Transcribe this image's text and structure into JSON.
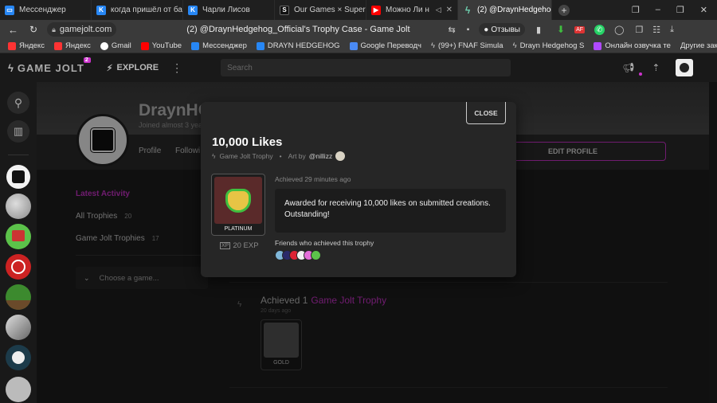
{
  "tabs": [
    {
      "label": "Мессенджер",
      "icon": "messenger-icon",
      "color": "#2787f5",
      "width": 115
    },
    {
      "label": "когда пришёл от бабуш",
      "icon": "vk-icon",
      "color": "#2787f5",
      "width": 115
    },
    {
      "label": "Чарли Лисов",
      "icon": "vk-icon",
      "color": "#2787f5",
      "width": 115
    },
    {
      "label": "Our Games × Supercell",
      "icon": "supercell-icon",
      "color": "#111111",
      "width": 115
    },
    {
      "label": "Можно Ли н",
      "icon": "youtube-icon",
      "color": "#ff0000",
      "width": 115
    },
    {
      "label": "(2) @DraynHedgehog",
      "icon": "gamejolt-icon",
      "color": "#2f7f6f",
      "width": 118,
      "active": true
    }
  ],
  "address": {
    "domain": "gamejolt.com",
    "page_title": "(2) @DraynHedgehog_Official's Trophy Case - Game Jolt",
    "reviews_label": "Отзывы"
  },
  "bookmarks": [
    {
      "label": "Яндекс",
      "color": "#ff3333"
    },
    {
      "label": "Яндекс",
      "color": "#ff3333"
    },
    {
      "label": "Gmail",
      "color": "#ffffff"
    },
    {
      "label": "YouTube",
      "color": "#ff0000"
    },
    {
      "label": "Мессенджер",
      "color": "#2787f5"
    },
    {
      "label": "DRAYN HEDGEHOG",
      "color": "#2787f5"
    },
    {
      "label": "Google Переводч",
      "color": "#4a8af4"
    },
    {
      "label": "(99+) FNAF Simula",
      "color": "#cccccc"
    },
    {
      "label": "Drayn Hedgehog S",
      "color": "#cccccc"
    },
    {
      "label": "Онлайн озвучка те",
      "color": "#b04aff"
    }
  ],
  "other_bookmarks": "Другие закладки",
  "gj": {
    "logo": "GAME JOLT",
    "notif_count": "2",
    "explore": "EXPLORE",
    "search_placeholder": "Search"
  },
  "profile": {
    "name": "DraynHG",
    "joined": "Joined almost 3 year",
    "tab_profile": "Profile",
    "tab_following": "Followi",
    "edit_profile": "EDIT PROFILE"
  },
  "filters": {
    "latest": "Latest Activity",
    "all_trophies": "All Trophies",
    "all_count": "20",
    "gj_trophies": "Game Jolt Trophies",
    "gj_count": "17",
    "choose_game": "Choose a game..."
  },
  "feed": {
    "achieved_prefix": "Achieved 1",
    "achieved_link": "Game Jolt Trophy",
    "time": "20 days ago",
    "card_label": "GOLD"
  },
  "modal": {
    "close": "CLOSE",
    "title": "10,000 Likes",
    "type": "Game Jolt Trophy",
    "art_by": "Art by",
    "artist": "@nillizz",
    "achieved": "Achieved 29 minutes ago",
    "description": "Awarded for receiving 10,000 likes on submitted creations. Outstanding!",
    "tier": "PLATINUM",
    "exp": "20 EXP",
    "friends_label": "Friends who achieved this trophy"
  },
  "colors": {
    "accent": "#cc33cc",
    "brand_green": "#2f7f6f"
  }
}
